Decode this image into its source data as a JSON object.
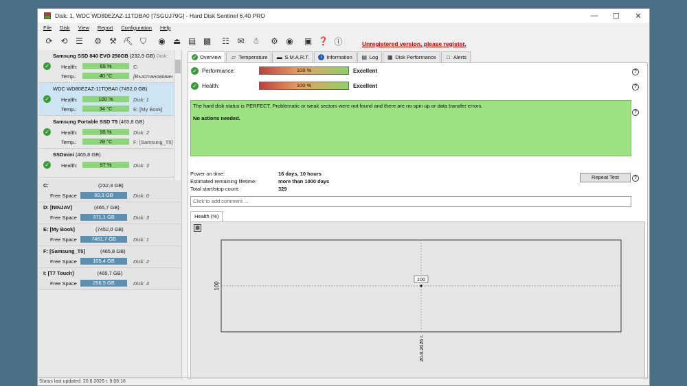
{
  "window": {
    "title": "Disk: 1, WDC WD80EZAZ-11TDBA0 [7SGUJ79G]  -  Hard Disk Sentinel 6.40 PRO"
  },
  "menu": [
    "File",
    "Disk",
    "View",
    "Report",
    "Configuration",
    "Help"
  ],
  "toolbar": {
    "icons": [
      "refresh-icon",
      "refresh-all-icon",
      "list-icon",
      "disk-wrench-icon",
      "disk-wrench-2-icon",
      "disk-test-icon",
      "disk-surface-icon",
      "globe-icon",
      "eject-icon",
      "disks-icon",
      "disk-remove-icon",
      "notepad-icon",
      "mail-icon",
      "network-icon",
      "gear-icon",
      "alert-settings-icon",
      "camera-icon",
      "help-icon",
      "info-icon"
    ],
    "unregistered": "Unregistered version, please register."
  },
  "disks": [
    {
      "name": "Samsung SSD 840 EVO 250GB",
      "size": "(232,9 GB)",
      "disk_tag": "Disk:",
      "health_label": "Health:",
      "health": "69 %",
      "health_extra": "C:",
      "temp_label": "Temp.:",
      "temp": "40 °C",
      "temp_extra": "[Възстановяван"
    },
    {
      "name": "WDC WD80EZAZ-11TDBA0",
      "size": "(7452,0 GB)",
      "disk_tag": "",
      "health_label": "Health:",
      "health": "100 %",
      "health_extra": "Disk: 1",
      "temp_label": "Temp.:",
      "temp": "34 °C",
      "temp_extra": "E: [My Book]"
    },
    {
      "name": "Samsung Portable SSD T5",
      "size": "(465,8 GB)",
      "disk_tag": "",
      "health_label": "Health:",
      "health": "95 %",
      "health_extra": "Disk: 2",
      "temp_label": "Temp.:",
      "temp": "28 °C",
      "temp_extra": "F: [Samsung_T5]"
    },
    {
      "name": "SSDmini",
      "size": "(465,8 GB)",
      "disk_tag": "",
      "health_label": "Health:",
      "health": "97 %",
      "health_extra": "Disk: 3",
      "temp_label": "",
      "temp": "",
      "temp_extra": ""
    }
  ],
  "volumes": [
    {
      "name": "C:",
      "size": "(232,3 GB)",
      "free_label": "Free Space",
      "free": "60,3 GB",
      "disk": "Disk: 0"
    },
    {
      "name": "D: [NINJAV]",
      "size": "(465,7 GB)",
      "free_label": "Free Space",
      "free": "371,1 GB",
      "disk": "Disk: 3"
    },
    {
      "name": "E: [My Book]",
      "size": "(7452,0 GB)",
      "free_label": "Free Space",
      "free": "7451,7 GB",
      "disk": "Disk: 1"
    },
    {
      "name": "F: [Samsung_T5]",
      "size": "(465,8 GB)",
      "free_label": "Free Space",
      "free": "105,4 GB",
      "disk": "Disk: 2"
    },
    {
      "name": "I: [T7 Touch]",
      "size": "(465,7 GB)",
      "free_label": "Free Space",
      "free": "256,5 GB",
      "disk": "Disk: 4"
    }
  ],
  "status_bar": "Status last updated: 20.8.2026 г. 9:06:18",
  "tabs": [
    "Overview",
    "Temperature",
    "S.M.A.R.T.",
    "Information",
    "Log",
    "Disk Performance",
    "Alerts"
  ],
  "overview": {
    "performance_label": "Performance:",
    "performance_value": "100 %",
    "performance_rating": "Excellent",
    "health_label": "Health:",
    "health_value": "100 %",
    "health_rating": "Excellent",
    "status_message": "The hard disk status is PERFECT. Problematic or weak sectors were not found and there are no spin up or data transfer errors.",
    "actions": "No actions needed.",
    "power_on_label": "Power on time:",
    "power_on_value": "16 days, 10 hours",
    "lifetime_label": "Estimated remaining lifetime:",
    "lifetime_value": "more than 1000 days",
    "startstop_label": "Total start/stop count:",
    "startstop_value": "329",
    "repeat_button": "Repeat Test",
    "comment_placeholder": "Click to add comment ...",
    "health_tab": "Health (%)"
  },
  "chart_data": {
    "type": "line",
    "x": [
      "20.8.2026 г."
    ],
    "series": [
      {
        "values": [
          100
        ]
      }
    ],
    "yticks": [
      "100"
    ],
    "xticks": [
      "20.8.2026 г."
    ],
    "data_labels": [
      "100"
    ],
    "grid": true
  }
}
